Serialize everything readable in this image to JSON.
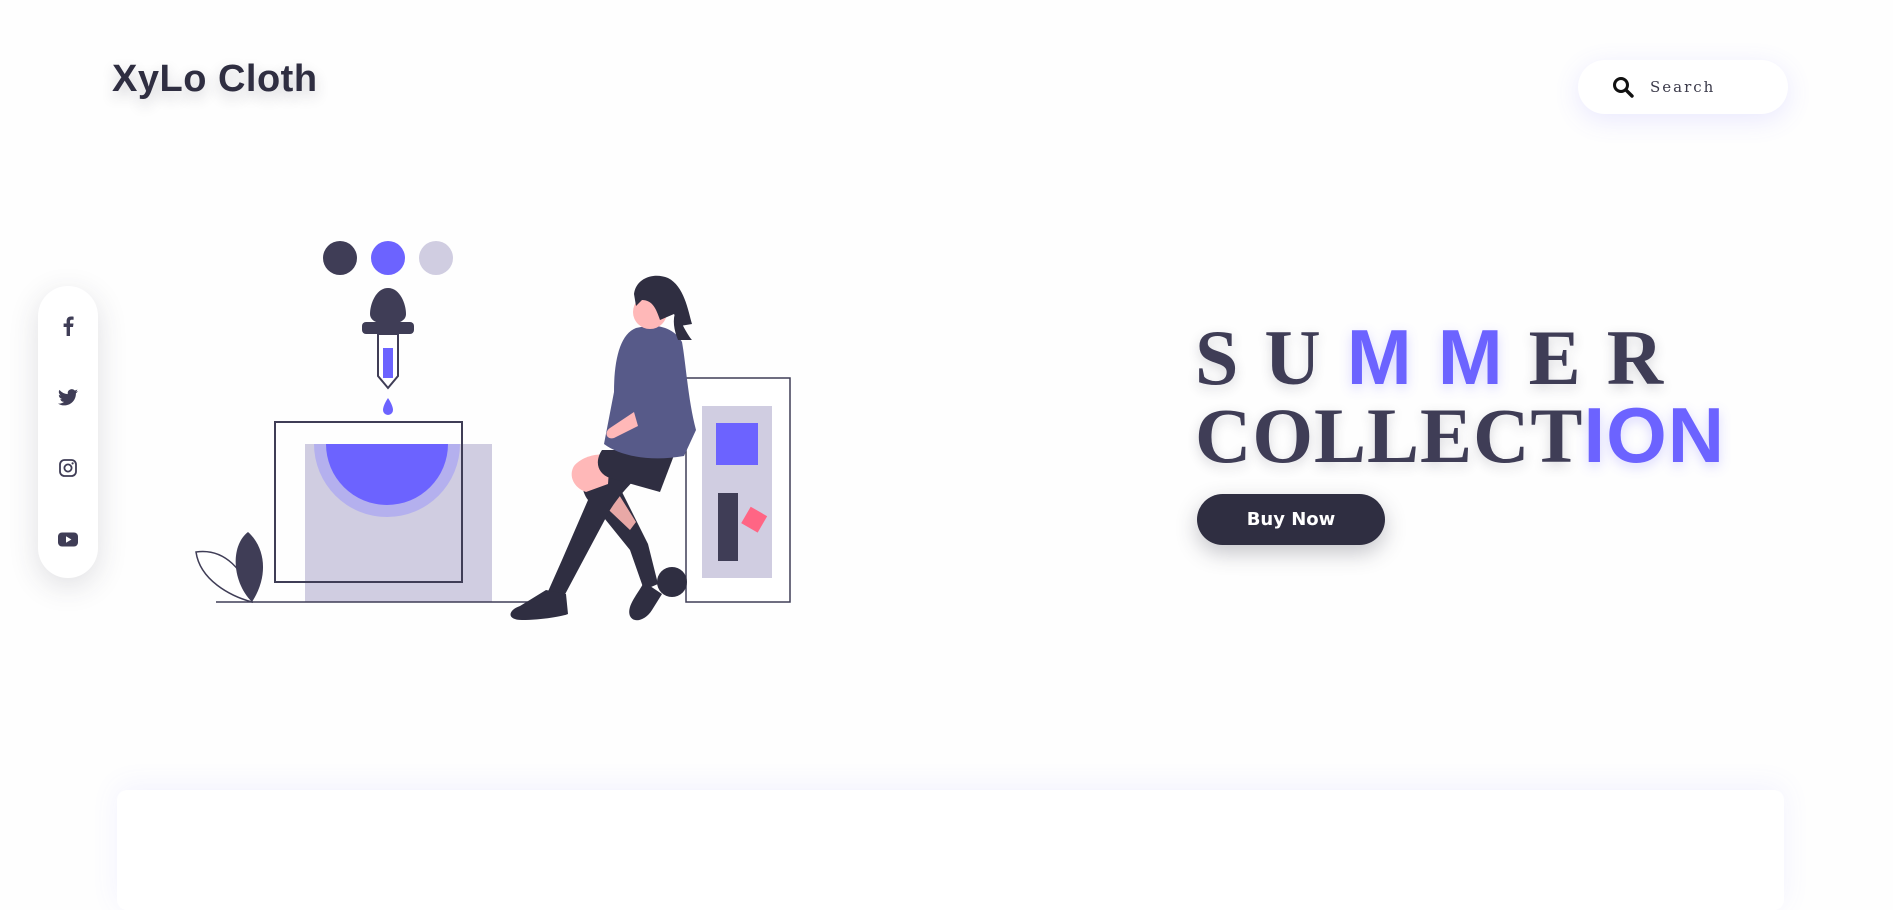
{
  "brand": {
    "logo_text": "XyLo Cloth"
  },
  "search": {
    "placeholder": "Search",
    "icon": "search-icon"
  },
  "social": [
    {
      "name": "facebook",
      "icon": "facebook-icon"
    },
    {
      "name": "twitter",
      "icon": "twitter-icon"
    },
    {
      "name": "instagram",
      "icon": "instagram-icon"
    },
    {
      "name": "youtube",
      "icon": "youtube-icon"
    }
  ],
  "hero": {
    "title_line1": {
      "part1": "SU",
      "part2": "MM",
      "part3": "ER"
    },
    "title_line2": {
      "part1": "COLLECT",
      "part2": "ION"
    },
    "cta_label": "Buy Now"
  },
  "colors": {
    "accent": "#6c63ff",
    "dark": "#2f2e41",
    "light": "#d0cde1",
    "pink": "#ff6584"
  }
}
